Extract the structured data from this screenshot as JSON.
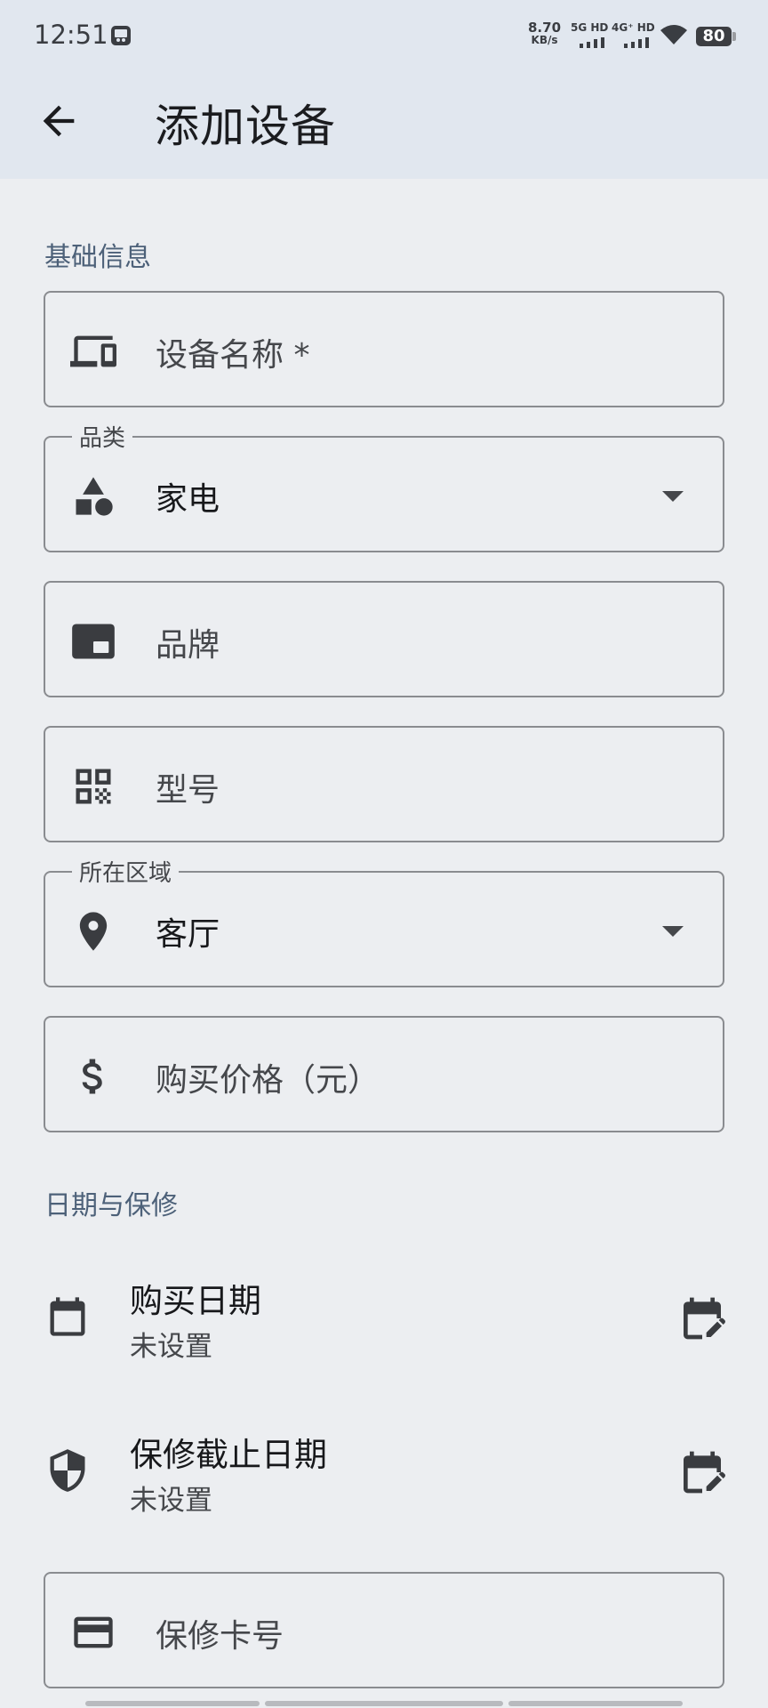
{
  "status_bar": {
    "time": "12:51",
    "speed_value": "8.70",
    "speed_unit": "KB/s",
    "net1": "5G HD",
    "net2": "4G⁺ HD",
    "battery": "80"
  },
  "app_bar": {
    "back_icon": "arrow-back-icon",
    "title": "添加设备"
  },
  "sections": {
    "basic": "基础信息",
    "dates": "日期与保修"
  },
  "fields": {
    "device_name": {
      "placeholder": "设备名称 *",
      "icon": "devices-icon"
    },
    "category": {
      "label": "品类",
      "value": "家电",
      "icon": "category-shapes-icon"
    },
    "brand": {
      "placeholder": "品牌",
      "icon": "brand-icon"
    },
    "model": {
      "placeholder": "型号",
      "icon": "qr-code-icon"
    },
    "area": {
      "label": "所在区域",
      "value": "客厅",
      "icon": "location-pin-icon"
    },
    "price": {
      "placeholder": "购买价格（元）",
      "icon": "dollar-icon"
    },
    "warranty_card": {
      "placeholder": "保修卡号",
      "icon": "credit-card-icon"
    }
  },
  "date_rows": {
    "purchase_date": {
      "title": "购买日期",
      "value": "未设置",
      "icon": "calendar-icon",
      "action_icon": "edit-calendar-icon"
    },
    "warranty_end": {
      "title": "保修截止日期",
      "value": "未设置",
      "icon": "shield-icon",
      "action_icon": "edit-calendar-icon"
    }
  },
  "colors": {
    "app_bar_bg": "#e1e7ef",
    "page_bg": "#eceef1",
    "section_label": "#4d6179",
    "outline": "#8a8c90"
  }
}
